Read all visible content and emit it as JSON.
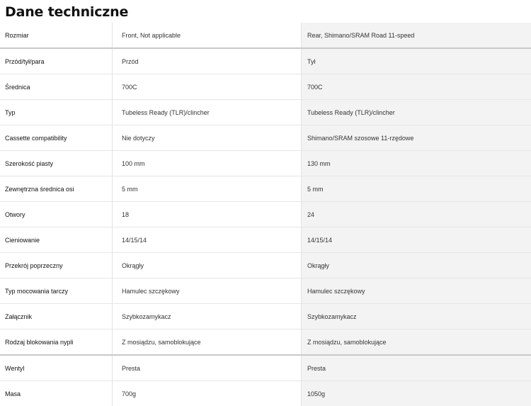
{
  "title": "Dane techniczne",
  "rows": [
    {
      "label": "Rozmiar",
      "front": "Front, Not applicable",
      "rear": "Rear, Shimano/SRAM Road 11-speed"
    },
    {
      "label": "Przód/tył/para",
      "front": "Przód",
      "rear": "Tył"
    },
    {
      "label": "Średnica",
      "front": "700C",
      "rear": "700C"
    },
    {
      "label": "Typ",
      "front": "Tubeless Ready (TLR)/clincher",
      "rear": "Tubeless Ready (TLR)/clincher"
    },
    {
      "label": "Cassette compatibility",
      "front": "Nie dotyczy",
      "rear": "Shimano/SRAM szosowe 11-rzędowe"
    },
    {
      "label": "Szerokość piasty",
      "front": "100 mm",
      "rear": "130 mm"
    },
    {
      "label": "Zewnętrzna średnica osi",
      "front": "5 mm",
      "rear": "5 mm"
    },
    {
      "label": "Otwory",
      "front": "18",
      "rear": "24"
    },
    {
      "label": "Cieniowanie",
      "front": "14/15/14",
      "rear": "14/15/14"
    },
    {
      "label": "Przekrój poprzeczny",
      "front": "Okrągły",
      "rear": "Okrągły"
    },
    {
      "label": "Typ mocowania tarczy",
      "front": "Hamulec szczękowy",
      "rear": "Hamulec szczękowy"
    },
    {
      "label": "Załącznik",
      "front": "Szybkozamykacz",
      "rear": "Szybkozamykacz"
    },
    {
      "label": "Rodzaj blokowania nypli",
      "front": "Z mosiądzu, samoblokujące",
      "rear": "Z mosiądzu, samoblokujące"
    },
    {
      "label": "Wentyl",
      "front": "Presta",
      "rear": "Presta"
    },
    {
      "label": "Masa",
      "front": "700g",
      "rear": "1050g"
    }
  ]
}
